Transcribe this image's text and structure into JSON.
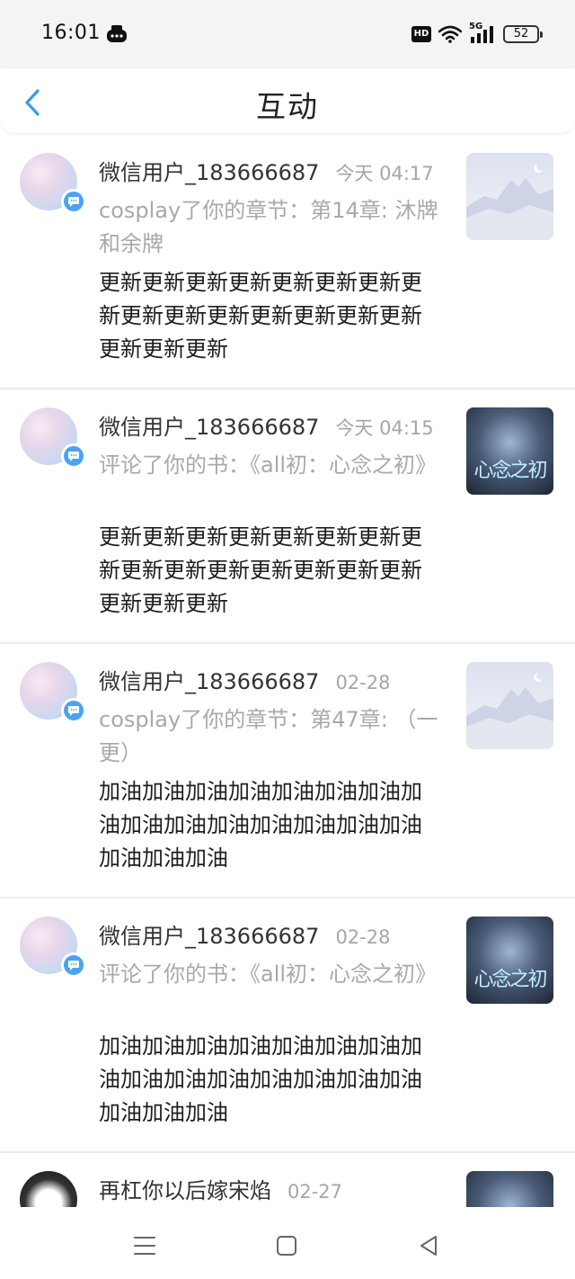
{
  "status_bar": {
    "time": "16:01",
    "hd_label": "HD",
    "network_label": "5G",
    "battery": "52"
  },
  "header": {
    "title": "互动"
  },
  "interactions": [
    {
      "username": "微信用户_183666687",
      "time": "今天 04:17",
      "action": "cosplay了你的章节：第14章: 沐牌和余牌",
      "content": "更新更新更新更新更新更新更新更新更新更新更新更新更新更新更新更新更新更新",
      "thumbnail": "mountain"
    },
    {
      "username": "微信用户_183666687",
      "time": "今天 04:15",
      "action": "评论了你的书：《all初：心念之初》",
      "content": "更新更新更新更新更新更新更新更新更新更新更新更新更新更新更新更新更新更新",
      "thumbnail": "cover",
      "thumbnail_text": "心念之初"
    },
    {
      "username": "微信用户_183666687",
      "time": "02-28",
      "action": "cosplay了你的章节：第47章: （一更）",
      "content": "加油加油加油加油加油加油加油加油加油加油加油加油加油加油加油加油加油加油",
      "thumbnail": "mountain"
    },
    {
      "username": "微信用户_183666687",
      "time": "02-28",
      "action": "评论了你的书：《all初：心念之初》",
      "content": "加油加油加油加油加油加油加油加油加油加油加油加油加油加油加油加油加油加油",
      "thumbnail": "cover",
      "thumbnail_text": "心念之初"
    },
    {
      "username": "再杠你以后嫁宋焰",
      "time": "02-27",
      "thumbnail": "cover"
    }
  ],
  "colors": {
    "accent": "#4aa3f0",
    "muted_text": "#a9a9a9"
  },
  "icons": {
    "back": "chevron-left-icon",
    "badge": "chat-bubble-icon",
    "nav_menu": "menu-icon",
    "nav_home": "square-icon",
    "nav_back": "triangle-back-icon"
  }
}
